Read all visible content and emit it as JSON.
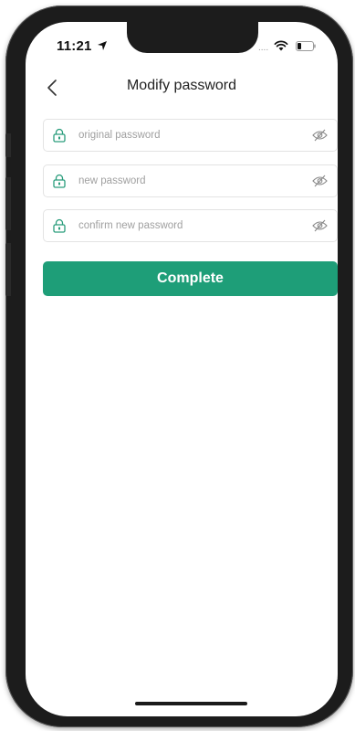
{
  "status_bar": {
    "time": "11:21",
    "signal_text": "....",
    "icons": [
      "location-arrow-icon",
      "wifi-icon",
      "battery-icon"
    ]
  },
  "nav": {
    "title": "Modify password",
    "back_icon": "chevron-left-icon"
  },
  "form": {
    "fields": [
      {
        "placeholder": "original password",
        "value": "",
        "left_icon": "lock-icon",
        "right_icon": "eye-slash-icon"
      },
      {
        "placeholder": "new password",
        "value": "",
        "left_icon": "lock-icon",
        "right_icon": "eye-slash-icon"
      },
      {
        "placeholder": "confirm new password",
        "value": "",
        "left_icon": "lock-icon",
        "right_icon": "eye-slash-icon"
      }
    ],
    "submit_label": "Complete"
  },
  "colors": {
    "accent": "#1e9e78",
    "lock_icon": "#2a9d7c",
    "field_border": "#e3e3e3",
    "placeholder": "#a0a0a0",
    "device_frame": "#1c1c1c"
  }
}
